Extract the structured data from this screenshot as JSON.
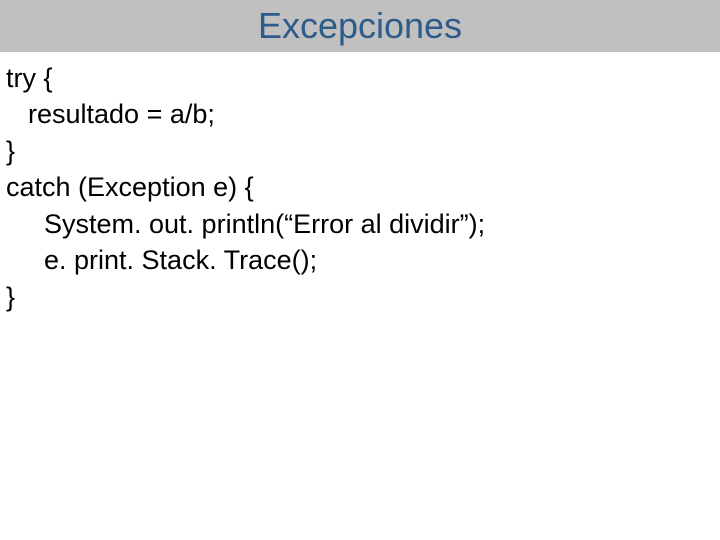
{
  "header": {
    "title": "Excepciones"
  },
  "code": {
    "line1": "try {",
    "line2": "resultado = a/b;",
    "line3": "}",
    "line4": "catch (Exception e) {",
    "line5": "System. out. println(“Error al dividir”);",
    "line6": "e. print. Stack. Trace();",
    "line7": "}"
  }
}
